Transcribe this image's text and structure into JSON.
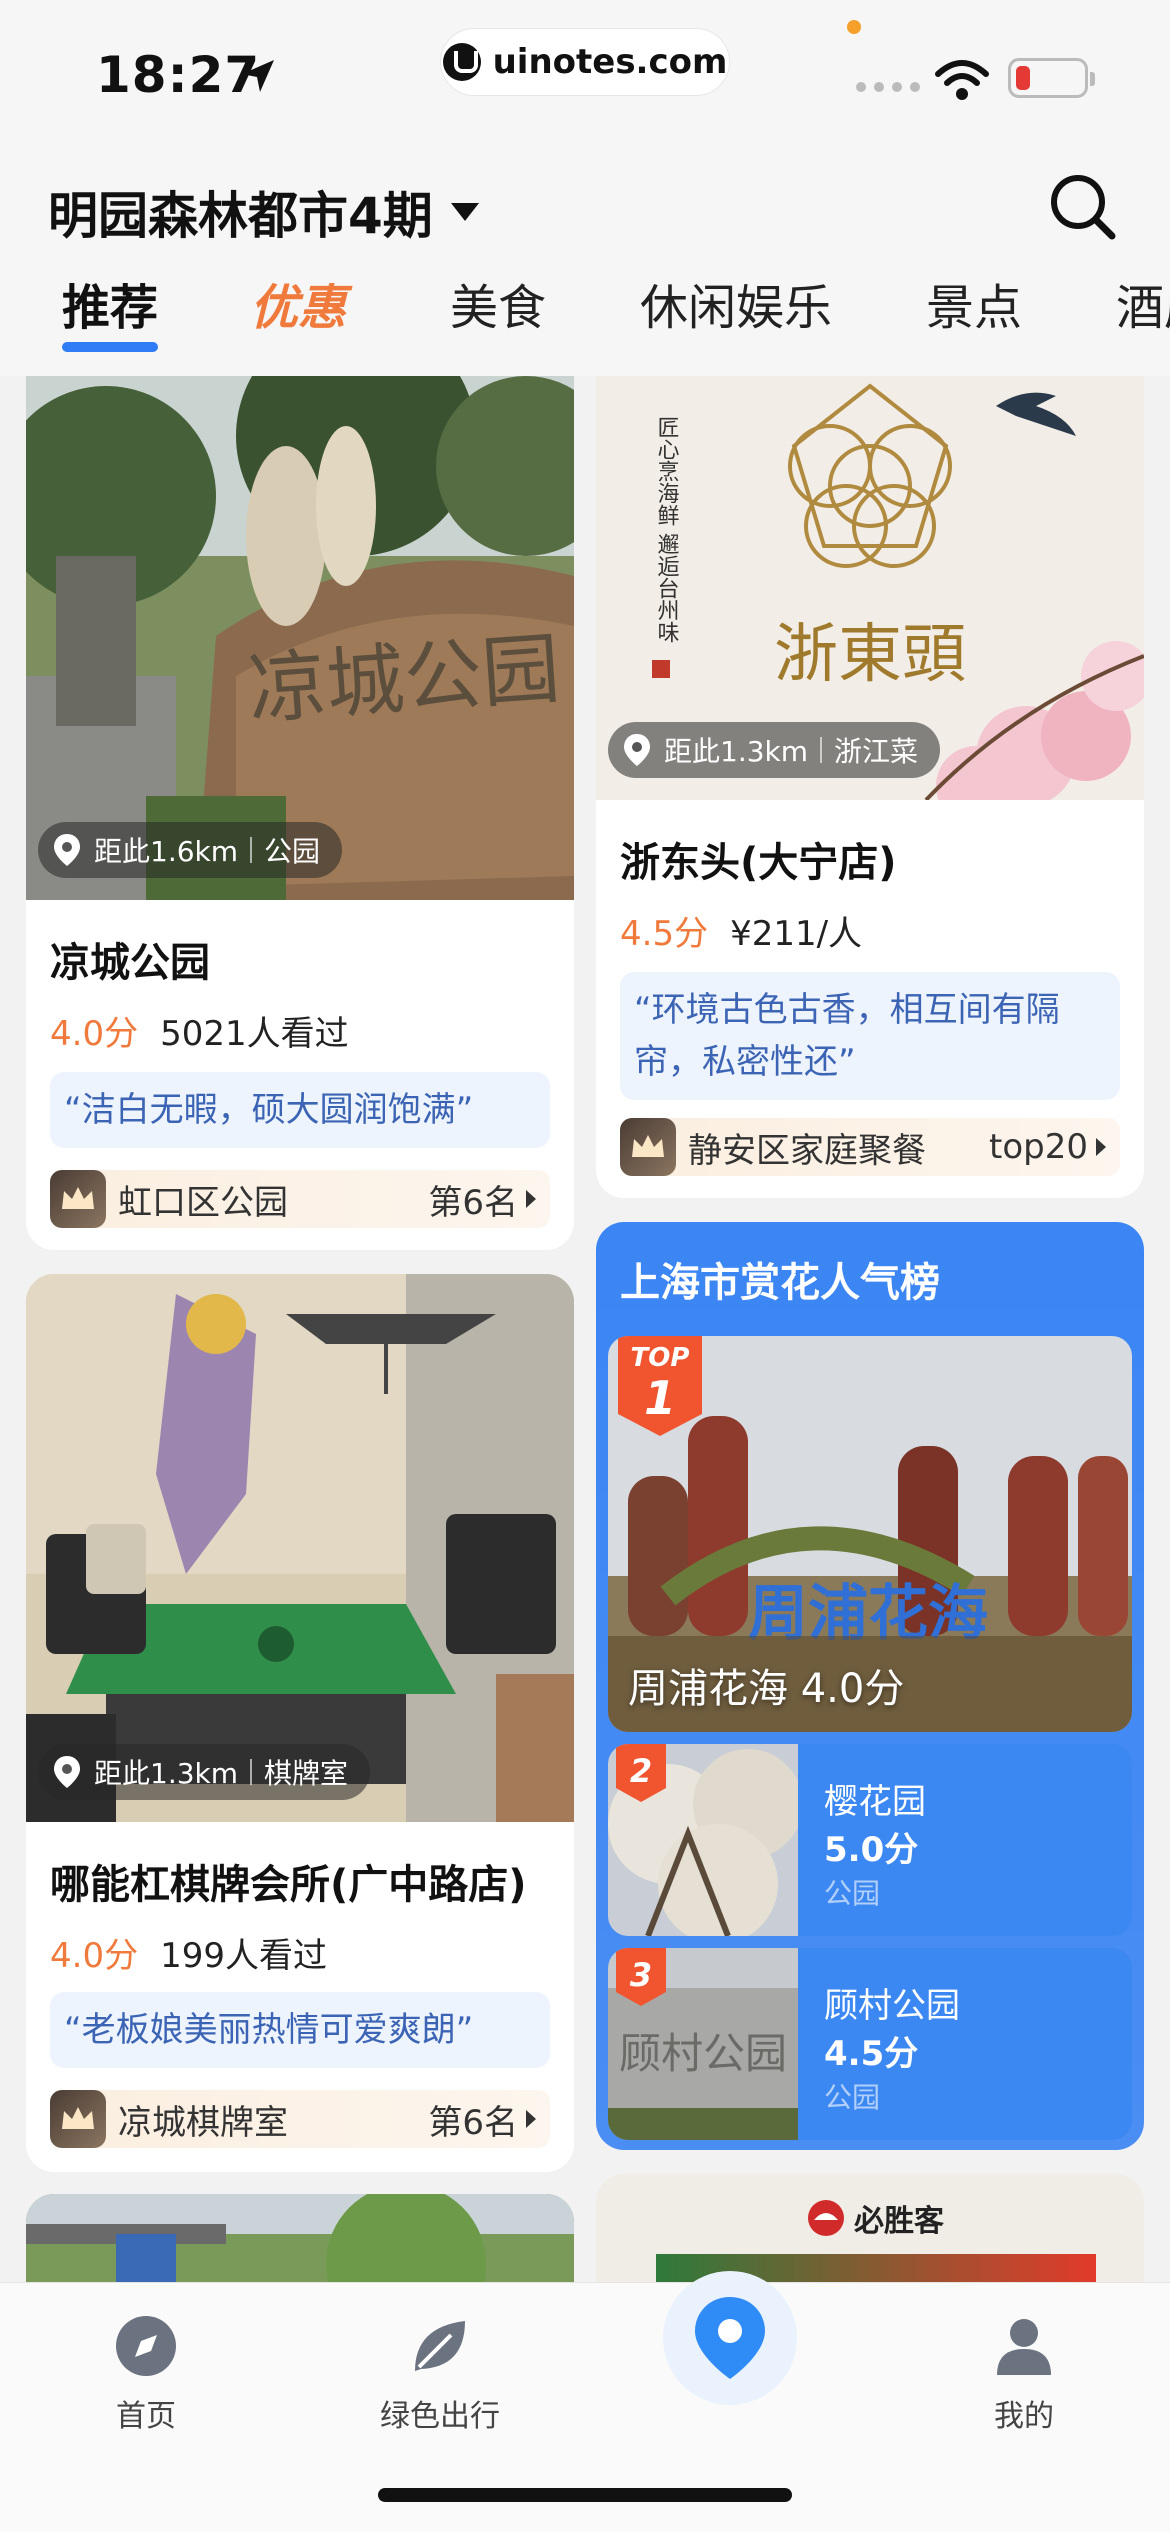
{
  "status_bar": {
    "time": "18:27",
    "url": "uinotes.com"
  },
  "header": {
    "city": "明园森林都市4期",
    "tabs": [
      {
        "label": "推荐"
      },
      {
        "label": "优惠"
      },
      {
        "label": "美食"
      },
      {
        "label": "休闲娱乐"
      },
      {
        "label": "景点"
      },
      {
        "label": "酒店"
      }
    ]
  },
  "cards": {
    "park": {
      "distance": "距此1.6km",
      "category": "公园",
      "stone_text": "凉城公园",
      "title": "凉城公园",
      "score": "4.0分",
      "views": "5021人看过",
      "quote": "“洁白无暇，硕大圆润饱满”",
      "rank_name": "虹口区公园",
      "rank_pos": "第6名"
    },
    "restaurant": {
      "distance": "距此1.3km",
      "category": "浙江菜",
      "logo_text": "浙東頭",
      "poem_text": "匠心烹海鲜 邂逅台州味",
      "title": "浙东头(大宁店)",
      "score": "4.5分",
      "price": "¥211/人",
      "quote": "“环境古色古香，相互间有隔帘，私密性还”",
      "rank_name": "静安区家庭聚餐",
      "rank_pos": "top20"
    },
    "chess": {
      "distance": "距此1.3km",
      "category": "棋牌室",
      "title": "哪能杠棋牌会所(广中路店)",
      "score": "4.0分",
      "views": "199人看过",
      "quote": "“老板娘美丽热情可爱爽朗”",
      "rank_name": "凉城棋牌室",
      "rank_pos": "第6名"
    },
    "pizza": {
      "brand": "必胜客"
    }
  },
  "ranking": {
    "title": "上海市赏花人气榜",
    "top_badge_top": "TOP",
    "top_badge_num": "1",
    "top1_sign": "周浦花海",
    "top1_label": "周浦花海 4.0分",
    "items": [
      {
        "num": "2",
        "name": "樱花园",
        "score": "5.0分",
        "type": "公园"
      },
      {
        "num": "3",
        "name": "顾村公园",
        "score": "4.5分",
        "type": "公园",
        "stone_text": "顾村公园"
      }
    ]
  },
  "bottom_nav": {
    "items": [
      {
        "label": "首页"
      },
      {
        "label": "绿色出行"
      },
      {
        "label": "我的"
      }
    ]
  },
  "colors": {
    "accent": "#2f7cf6",
    "score": "#f07a3c",
    "rank_bg": "#3b86f4"
  }
}
